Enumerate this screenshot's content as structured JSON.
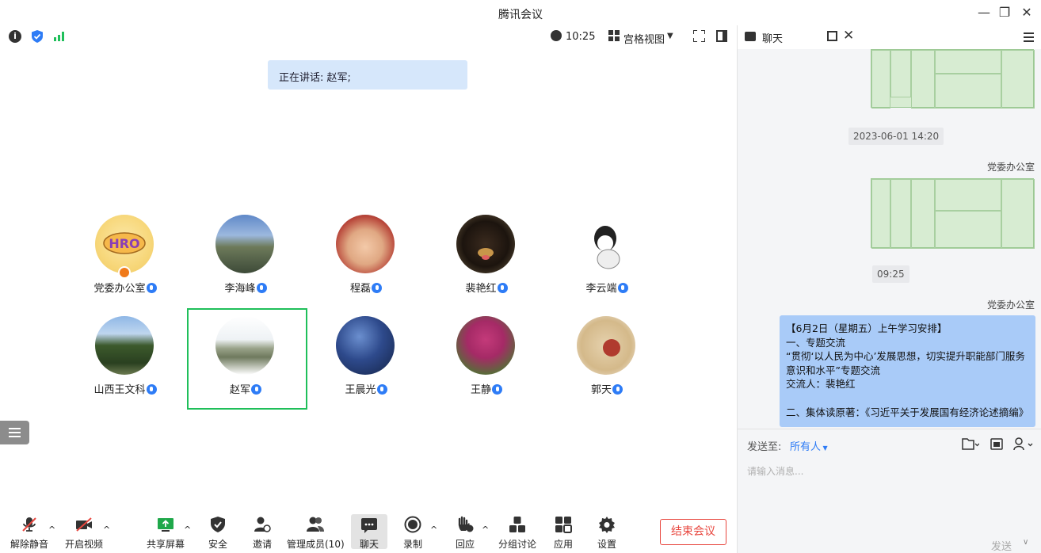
{
  "window": {
    "title": "腾讯会议"
  },
  "topbar": {
    "time": "10:25",
    "view_label": "宫格视图"
  },
  "banner": {
    "speaking": "正在讲话: 赵军;"
  },
  "participants": [
    {
      "name": "党委办公室",
      "host": true
    },
    {
      "name": "李海峰"
    },
    {
      "name": "程磊"
    },
    {
      "name": "裴艳红"
    },
    {
      "name": "李云端"
    },
    {
      "name": "山西王文科"
    },
    {
      "name": "赵军",
      "active": true
    },
    {
      "name": "王晨光"
    },
    {
      "name": "王静"
    },
    {
      "name": "郭天"
    }
  ],
  "toolbar": {
    "mute": "解除静音",
    "video": "开启视频",
    "share": "共享屏幕",
    "security": "安全",
    "invite": "邀请",
    "members": "管理成员(10)",
    "chat": "聊天",
    "record": "录制",
    "react": "回应",
    "breakout": "分组讨论",
    "apps": "应用",
    "settings": "设置",
    "end": "结束会议"
  },
  "chat": {
    "title": "聊天",
    "messages": {
      "ts1": "2023-06-01 14:20",
      "sender1": "党委办公室",
      "ts2": "09:25",
      "sender2": "党委办公室",
      "bubble_lines": [
        "【6月2日（星期五）上午学习安排】",
        "一、专题交流",
        "“贯彻‘以人民为中心’发展思想，切实提升职能部门服务意识和水平”专题交流",
        "交流人：裴艳红",
        "",
        "二、集体读原著：《习近平关于发展国有经济论述摘编》"
      ]
    },
    "send_to_label": "发送至:",
    "send_to_value": "所有人",
    "input_placeholder": "请输入消息...",
    "send": "发送"
  },
  "colors": {
    "accent": "#2e7cf6",
    "active_border": "#1fbf5a",
    "end": "#e8473f"
  }
}
